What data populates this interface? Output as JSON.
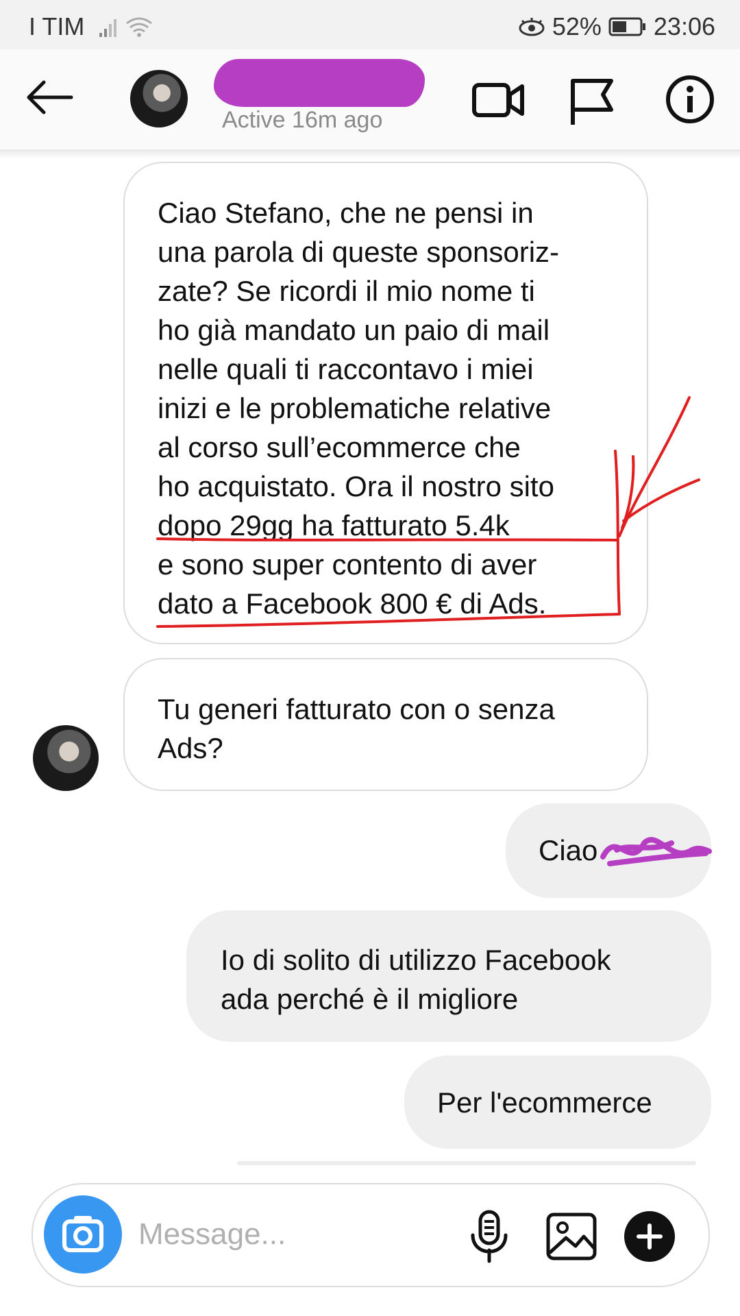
{
  "status_bar": {
    "carrier": "I TIM",
    "battery": "52%",
    "time": "23:06"
  },
  "header": {
    "status": "Active 16m ago",
    "icons": [
      "back-arrow-icon",
      "video-call-icon",
      "flag-icon",
      "info-icon"
    ]
  },
  "messages": [
    {
      "direction": "incoming",
      "text": "Ciao Stefano, che ne pensi in\nuna parola di queste sponsoriz-\nzate? Se ricordi il mio nome ti\nho già mandato un paio di mail\nnelle quali ti raccontavo i miei\ninizi e le problematiche relative\nal corso sull’ecommerce che\nho acquistato. Ora il nostro sito\ndopo 29gg ha fatturato 5.4k\ne  sono super contento di aver\ndato a Facebook 800 € di Ads."
    },
    {
      "direction": "incoming",
      "text": "Tu generi fatturato con o senza\nAds?"
    },
    {
      "direction": "outgoing",
      "text": "Ciao"
    },
    {
      "direction": "outgoing",
      "text": "Io di solito di utilizzo Facebook\nada perché è il migliore"
    },
    {
      "direction": "outgoing",
      "text": "Per l'ecommerce"
    }
  ],
  "composer": {
    "placeholder": "Message...",
    "icons": [
      "camera-icon",
      "microphone-icon",
      "gallery-icon",
      "plus-icon"
    ]
  },
  "colors": {
    "accent_blue": "#3897f0",
    "annotation_red": "#e02020",
    "redaction_purple": "#b63ec2"
  }
}
